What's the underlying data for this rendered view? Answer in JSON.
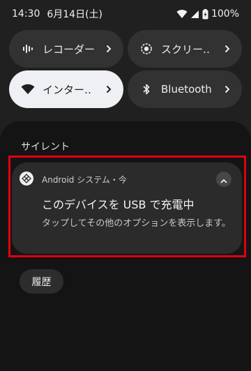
{
  "status_bar": {
    "time": "14:30",
    "date": "6月14日(土)",
    "battery": "100%",
    "icons": [
      "wifi-icon",
      "signal-icon",
      "battery-icon"
    ]
  },
  "quick_tiles": [
    {
      "label": "レコーダー",
      "icon": "recorder-icon",
      "active": false
    },
    {
      "label": "スクリー‥",
      "icon": "screen-record-icon",
      "active": false
    },
    {
      "label": "インター‥",
      "icon": "wifi-icon",
      "active": true
    },
    {
      "label": "Bluetooth",
      "icon": "bluetooth-icon",
      "active": false
    }
  ],
  "notifications": {
    "section_label": "サイレント",
    "card": {
      "app_header": "Android システム・今",
      "title": "このデバイスを USB で充電中",
      "body": "タップしてその他のオプションを表示します。"
    },
    "history_label": "履歴"
  },
  "colors": {
    "background": "#202020",
    "shade": "#141414",
    "tile": "#323232",
    "tile_active": "#eef0f3",
    "card": "#2b2b2b",
    "highlight": "#e1000f"
  }
}
